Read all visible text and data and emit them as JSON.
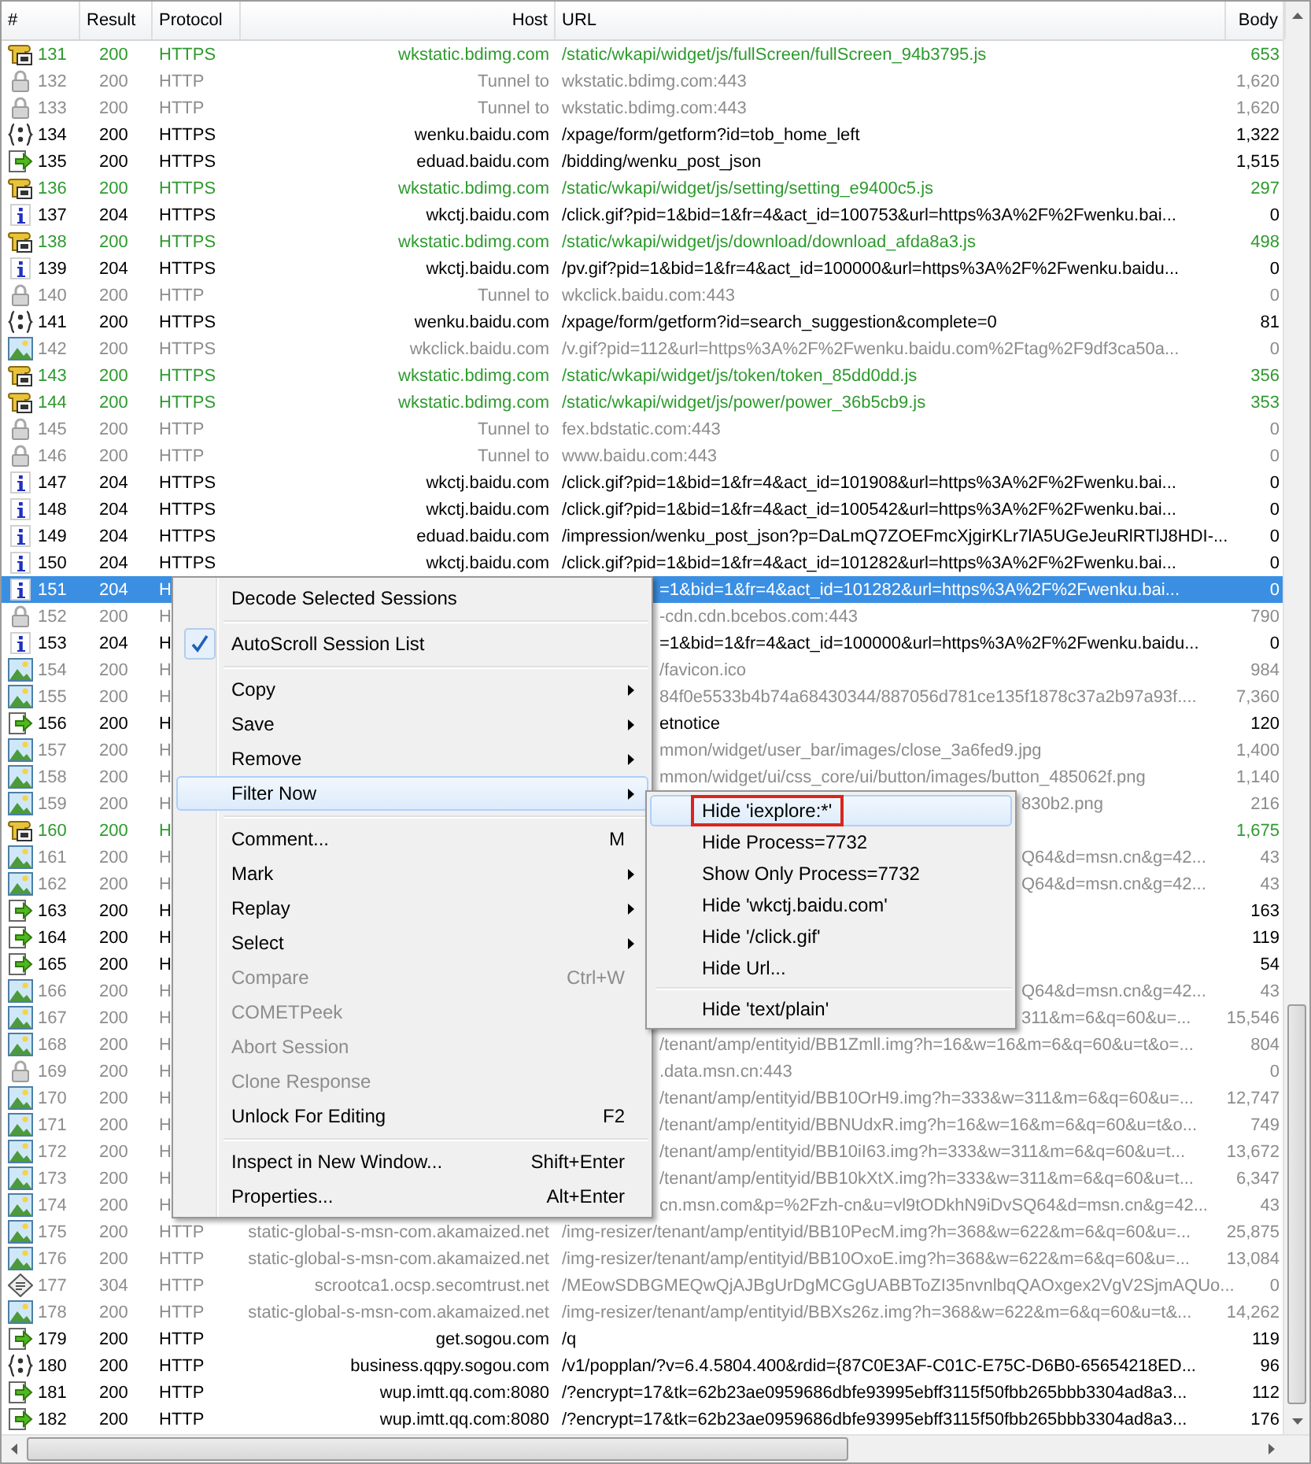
{
  "table": {
    "columns": [
      "#",
      "Result",
      "Protocol",
      "Host",
      "URL",
      "Body"
    ],
    "rows": [
      {
        "num": "131",
        "result": "200",
        "protocol": "HTTPS",
        "host": "wkstatic.bdimg.com",
        "url": "/static/wkapi/widget/js/fullScreen/fullScreen_94b3795.js",
        "body": "653",
        "kind": "script",
        "color": "#2e9a2e",
        "selected": false
      },
      {
        "num": "132",
        "result": "200",
        "protocol": "HTTP",
        "host": "Tunnel to",
        "url": "wkstatic.bdimg.com:443",
        "body": "1,620",
        "kind": "lock",
        "color": "#8c8c8c",
        "selected": false
      },
      {
        "num": "133",
        "result": "200",
        "protocol": "HTTP",
        "host": "Tunnel to",
        "url": "wkstatic.bdimg.com:443",
        "body": "1,620",
        "kind": "lock",
        "color": "#8c8c8c",
        "selected": false
      },
      {
        "num": "134",
        "result": "200",
        "protocol": "HTTPS",
        "host": "wenku.baidu.com",
        "url": "/xpage/form/getform?id=tob_home_left",
        "body": "1,322",
        "kind": "braces",
        "color": "#000000",
        "selected": false
      },
      {
        "num": "135",
        "result": "200",
        "protocol": "HTTPS",
        "host": "eduad.baidu.com",
        "url": "/bidding/wenku_post_json",
        "body": "1,515",
        "kind": "arrow",
        "color": "#000000",
        "selected": false
      },
      {
        "num": "136",
        "result": "200",
        "protocol": "HTTPS",
        "host": "wkstatic.bdimg.com",
        "url": "/static/wkapi/widget/js/setting/setting_e9400c5.js",
        "body": "297",
        "kind": "script",
        "color": "#2e9a2e",
        "selected": false
      },
      {
        "num": "137",
        "result": "204",
        "protocol": "HTTPS",
        "host": "wkctj.baidu.com",
        "url": "/click.gif?pid=1&bid=1&fr=4&act_id=100753&url=https%3A%2F%2Fwenku.bai...",
        "body": "0",
        "kind": "info",
        "color": "#000000",
        "selected": false
      },
      {
        "num": "138",
        "result": "200",
        "protocol": "HTTPS",
        "host": "wkstatic.bdimg.com",
        "url": "/static/wkapi/widget/js/download/download_afda8a3.js",
        "body": "498",
        "kind": "script",
        "color": "#2e9a2e",
        "selected": false
      },
      {
        "num": "139",
        "result": "204",
        "protocol": "HTTPS",
        "host": "wkctj.baidu.com",
        "url": "/pv.gif?pid=1&bid=1&fr=4&act_id=100000&url=https%3A%2F%2Fwenku.baidu...",
        "body": "0",
        "kind": "info",
        "color": "#000000",
        "selected": false
      },
      {
        "num": "140",
        "result": "200",
        "protocol": "HTTP",
        "host": "Tunnel to",
        "url": "wkclick.baidu.com:443",
        "body": "0",
        "kind": "lock",
        "color": "#8c8c8c",
        "selected": false
      },
      {
        "num": "141",
        "result": "200",
        "protocol": "HTTPS",
        "host": "wenku.baidu.com",
        "url": "/xpage/form/getform?id=search_suggestion&complete=0",
        "body": "81",
        "kind": "braces",
        "color": "#000000",
        "selected": false
      },
      {
        "num": "142",
        "result": "200",
        "protocol": "HTTPS",
        "host": "wkclick.baidu.com",
        "url": "/v.gif?pid=112&url=https%3A%2F%2Fwenku.baidu.com%2Ftag%2F9df3ca50a...",
        "body": "0",
        "kind": "image",
        "color": "#8c8c8c",
        "selected": false
      },
      {
        "num": "143",
        "result": "200",
        "protocol": "HTTPS",
        "host": "wkstatic.bdimg.com",
        "url": "/static/wkapi/widget/js/token/token_85dd0dd.js",
        "body": "356",
        "kind": "script",
        "color": "#2e9a2e",
        "selected": false
      },
      {
        "num": "144",
        "result": "200",
        "protocol": "HTTPS",
        "host": "wkstatic.bdimg.com",
        "url": "/static/wkapi/widget/js/power/power_36b5cb9.js",
        "body": "353",
        "kind": "script",
        "color": "#2e9a2e",
        "selected": false
      },
      {
        "num": "145",
        "result": "200",
        "protocol": "HTTP",
        "host": "Tunnel to",
        "url": "fex.bdstatic.com:443",
        "body": "0",
        "kind": "lock",
        "color": "#8c8c8c",
        "selected": false
      },
      {
        "num": "146",
        "result": "200",
        "protocol": "HTTP",
        "host": "Tunnel to",
        "url": "www.baidu.com:443",
        "body": "0",
        "kind": "lock",
        "color": "#8c8c8c",
        "selected": false
      },
      {
        "num": "147",
        "result": "204",
        "protocol": "HTTPS",
        "host": "wkctj.baidu.com",
        "url": "/click.gif?pid=1&bid=1&fr=4&act_id=101908&url=https%3A%2F%2Fwenku.bai...",
        "body": "0",
        "kind": "info",
        "color": "#000000",
        "selected": false
      },
      {
        "num": "148",
        "result": "204",
        "protocol": "HTTPS",
        "host": "wkctj.baidu.com",
        "url": "/click.gif?pid=1&bid=1&fr=4&act_id=100542&url=https%3A%2F%2Fwenku.bai...",
        "body": "0",
        "kind": "info",
        "color": "#000000",
        "selected": false
      },
      {
        "num": "149",
        "result": "204",
        "protocol": "HTTPS",
        "host": "eduad.baidu.com",
        "url": "/impression/wenku_post_json?p=DaLmQ7ZOEFmcXjgirKLr7lA5UGeJeuRlRTlJ8HDI-...",
        "body": "0",
        "kind": "info",
        "color": "#000000",
        "selected": false
      },
      {
        "num": "150",
        "result": "204",
        "protocol": "HTTPS",
        "host": "wkctj.baidu.com",
        "url": "/click.gif?pid=1&bid=1&fr=4&act_id=101282&url=https%3A%2F%2Fwenku.bai...",
        "body": "0",
        "kind": "info",
        "color": "#000000",
        "selected": false
      },
      {
        "num": "151",
        "result": "204",
        "protocol": "H",
        "url": "=1&bid=1&fr=4&act_id=101282&url=https%3A%2F%2Fwenku.bai...",
        "body": "0",
        "kind": "info",
        "selected": true
      },
      {
        "num": "152",
        "result": "200",
        "protocol": "H",
        "url": "-cdn.cdn.bcebos.com:443",
        "body": "790",
        "kind": "lock",
        "color": "#8c8c8c",
        "selected": false
      },
      {
        "num": "153",
        "result": "204",
        "protocol": "H",
        "url": "=1&bid=1&fr=4&act_id=100000&url=https%3A%2F%2Fwenku.baidu...",
        "body": "0",
        "kind": "info",
        "color": "#000000",
        "selected": false
      },
      {
        "num": "154",
        "result": "200",
        "protocol": "H",
        "url": "/favicon.ico",
        "body": "984",
        "kind": "image",
        "color": "#8c8c8c",
        "selected": false
      },
      {
        "num": "155",
        "result": "200",
        "protocol": "H",
        "url": "84f0e5533b4b74a68430344/887056d781ce135f1878c37a2b97a93f....",
        "body": "7,360",
        "kind": "image",
        "color": "#8c8c8c",
        "selected": false
      },
      {
        "num": "156",
        "result": "200",
        "protocol": "H",
        "url": "etnotice",
        "body": "120",
        "kind": "arrow",
        "color": "#000000",
        "selected": false
      },
      {
        "num": "157",
        "result": "200",
        "protocol": "H",
        "url": "mmon/widget/user_bar/images/close_3a6fed9.jpg",
        "body": "1,400",
        "kind": "image",
        "color": "#8c8c8c",
        "selected": false
      },
      {
        "num": "158",
        "result": "200",
        "protocol": "H",
        "url": "mmon/widget/ui/css_core/ui/button/images/button_485062f.png",
        "body": "1,140",
        "kind": "image",
        "color": "#8c8c8c",
        "selected": false
      },
      {
        "num": "159",
        "result": "200",
        "protocol": "H",
        "url": "830b2.png",
        "body": "216",
        "kind": "image",
        "color": "#8c8c8c",
        "selected": false
      },
      {
        "num": "160",
        "result": "200",
        "protocol": "H",
        "body": "1,675",
        "kind": "script",
        "color": "#2e9a2e",
        "selected": false
      },
      {
        "num": "161",
        "result": "200",
        "protocol": "H",
        "url": "Q64&d=msn.cn&g=42...",
        "body": "43",
        "kind": "image",
        "color": "#8c8c8c",
        "selected": false
      },
      {
        "num": "162",
        "result": "200",
        "protocol": "H",
        "url": "Q64&d=msn.cn&g=42...",
        "body": "43",
        "kind": "image",
        "color": "#8c8c8c",
        "selected": false
      },
      {
        "num": "163",
        "result": "200",
        "protocol": "H",
        "body": "163",
        "kind": "arrow",
        "color": "#000000",
        "selected": false
      },
      {
        "num": "164",
        "result": "200",
        "protocol": "H",
        "body": "119",
        "kind": "arrow",
        "color": "#000000",
        "selected": false
      },
      {
        "num": "165",
        "result": "200",
        "protocol": "H",
        "body": "54",
        "kind": "arrow",
        "color": "#000000",
        "selected": false
      },
      {
        "num": "166",
        "result": "200",
        "protocol": "H",
        "url": "Q64&d=msn.cn&g=42...",
        "body": "43",
        "kind": "image",
        "color": "#8c8c8c",
        "selected": false
      },
      {
        "num": "167",
        "result": "200",
        "protocol": "H",
        "url": "311&m=6&q=60&u=...",
        "body": "15,546",
        "kind": "image",
        "color": "#8c8c8c",
        "selected": false
      },
      {
        "num": "168",
        "result": "200",
        "protocol": "H",
        "url": "/tenant/amp/entityid/BB1Zmll.img?h=16&w=16&m=6&q=60&u=t&o=...",
        "body": "804",
        "kind": "image",
        "color": "#8c8c8c",
        "selected": false
      },
      {
        "num": "169",
        "result": "200",
        "protocol": "H",
        "url": ".data.msn.cn:443",
        "body": "0",
        "kind": "lock",
        "color": "#8c8c8c",
        "selected": false
      },
      {
        "num": "170",
        "result": "200",
        "protocol": "H",
        "url": "/tenant/amp/entityid/BB10OrH9.img?h=333&w=311&m=6&q=60&u=...",
        "body": "12,747",
        "kind": "image",
        "color": "#8c8c8c",
        "selected": false
      },
      {
        "num": "171",
        "result": "200",
        "protocol": "H",
        "url": "/tenant/amp/entityid/BBNUdxR.img?h=16&w=16&m=6&q=60&u=t&o...",
        "body": "749",
        "kind": "image",
        "color": "#8c8c8c",
        "selected": false
      },
      {
        "num": "172",
        "result": "200",
        "protocol": "H",
        "url": "/tenant/amp/entityid/BB10iI63.img?h=333&w=311&m=6&q=60&u=t...",
        "body": "13,672",
        "kind": "image",
        "color": "#8c8c8c",
        "selected": false
      },
      {
        "num": "173",
        "result": "200",
        "protocol": "H",
        "url": "/tenant/amp/entityid/BB10kXtX.img?h=333&w=311&m=6&q=60&u=t...",
        "body": "6,347",
        "kind": "image",
        "color": "#8c8c8c",
        "selected": false
      },
      {
        "num": "174",
        "result": "200",
        "protocol": "H",
        "url": "cn.msn.com&p=%2Fzh-cn&u=vl9tODkhN9iDvSQ64&d=msn.cn&g=42...",
        "body": "43",
        "kind": "image",
        "color": "#8c8c8c",
        "selected": false
      },
      {
        "num": "175",
        "result": "200",
        "protocol": "HTTP",
        "host": "static-global-s-msn-com.akamaized.net",
        "url": "/img-resizer/tenant/amp/entityid/BB10PecM.img?h=368&w=622&m=6&q=60&u=...",
        "body": "25,875",
        "kind": "image",
        "color": "#8c8c8c",
        "selected": false
      },
      {
        "num": "176",
        "result": "200",
        "protocol": "HTTP",
        "host": "static-global-s-msn-com.akamaized.net",
        "url": "/img-resizer/tenant/amp/entityid/BB10OxoE.img?h=368&w=622&m=6&q=60&u=...",
        "body": "13,084",
        "kind": "image",
        "color": "#8c8c8c",
        "selected": false
      },
      {
        "num": "177",
        "result": "304",
        "protocol": "HTTP",
        "host": "scrootca1.ocsp.secomtrust.net",
        "url": "/MEowSDBGMEQwQjAJBgUrDgMCGgUABBToZI35nvnlbqQAOxgex2VgV2SjmAQUo...",
        "body": "0",
        "kind": "certificate",
        "color": "#8c8c8c",
        "selected": false
      },
      {
        "num": "178",
        "result": "200",
        "protocol": "HTTP",
        "host": "static-global-s-msn-com.akamaized.net",
        "url": "/img-resizer/tenant/amp/entityid/BBXs26z.img?h=368&w=622&m=6&q=60&u=t&...",
        "body": "14,262",
        "kind": "image",
        "color": "#8c8c8c",
        "selected": false
      },
      {
        "num": "179",
        "result": "200",
        "protocol": "HTTP",
        "host": "get.sogou.com",
        "url": "/q",
        "body": "119",
        "kind": "arrow",
        "color": "#000000",
        "selected": false
      },
      {
        "num": "180",
        "result": "200",
        "protocol": "HTTP",
        "host": "business.qqpy.sogou.com",
        "url": "/v1/popplan/?v=6.4.5804.400&rdid={87C0E3AF-C01C-E75C-D6B0-65654218ED...",
        "body": "96",
        "kind": "braces",
        "color": "#000000",
        "selected": false
      },
      {
        "num": "181",
        "result": "200",
        "protocol": "HTTP",
        "host": "wup.imtt.qq.com:8080",
        "url": "/?encrypt=17&tk=62b23ae0959686dbfe93995ebff3115f50fbb265bbb3304ad8a3...",
        "body": "112",
        "kind": "arrow",
        "color": "#000000",
        "selected": false
      },
      {
        "num": "182",
        "result": "200",
        "protocol": "HTTP",
        "host": "wup.imtt.qq.com:8080",
        "url": "/?encrypt=17&tk=62b23ae0959686dbfe93995ebff3115f50fbb265bbb3304ad8a3...",
        "body": "176",
        "kind": "arrow",
        "color": "#000000",
        "selected": false
      }
    ]
  },
  "context_menu": {
    "items": [
      {
        "kind": "item",
        "label": "Decode Selected Sessions",
        "submenu": false,
        "checked": false,
        "disabled": false,
        "selected": false
      },
      {
        "kind": "separator"
      },
      {
        "kind": "item",
        "label": "AutoScroll Session List",
        "submenu": false,
        "checked": true,
        "disabled": false,
        "selected": false
      },
      {
        "kind": "separator"
      },
      {
        "kind": "item",
        "label": "Copy",
        "submenu": true,
        "checked": false,
        "disabled": false,
        "selected": false
      },
      {
        "kind": "item",
        "label": "Save",
        "submenu": true,
        "checked": false,
        "disabled": false,
        "selected": false
      },
      {
        "kind": "item",
        "label": "Remove",
        "submenu": true,
        "checked": false,
        "disabled": false,
        "selected": false
      },
      {
        "kind": "item",
        "label": "Filter Now",
        "submenu": true,
        "checked": false,
        "disabled": false,
        "selected": true
      },
      {
        "kind": "separator"
      },
      {
        "kind": "item",
        "label": "Comment...",
        "shortcut": "M",
        "submenu": false,
        "checked": false,
        "disabled": false,
        "selected": false
      },
      {
        "kind": "item",
        "label": "Mark",
        "submenu": true,
        "checked": false,
        "disabled": false,
        "selected": false
      },
      {
        "kind": "item",
        "label": "Replay",
        "submenu": true,
        "checked": false,
        "disabled": false,
        "selected": false
      },
      {
        "kind": "item",
        "label": "Select",
        "submenu": true,
        "checked": false,
        "disabled": false,
        "selected": false
      },
      {
        "kind": "item",
        "label": "Compare",
        "shortcut": "Ctrl+W",
        "submenu": false,
        "checked": false,
        "disabled": true,
        "selected": false
      },
      {
        "kind": "item",
        "label": "COMETPeek",
        "submenu": false,
        "checked": false,
        "disabled": true,
        "selected": false
      },
      {
        "kind": "item",
        "label": "Abort Session",
        "submenu": false,
        "checked": false,
        "disabled": true,
        "selected": false
      },
      {
        "kind": "item",
        "label": "Clone Response",
        "submenu": false,
        "checked": false,
        "disabled": true,
        "selected": false
      },
      {
        "kind": "item",
        "label": "Unlock For Editing",
        "shortcut": "F2",
        "submenu": false,
        "checked": false,
        "disabled": false,
        "selected": false
      },
      {
        "kind": "separator"
      },
      {
        "kind": "item",
        "label": "Inspect in New Window...",
        "shortcut": "Shift+Enter",
        "submenu": false,
        "checked": false,
        "disabled": false,
        "selected": false
      },
      {
        "kind": "item",
        "label": "Properties...",
        "shortcut": "Alt+Enter",
        "submenu": false,
        "checked": false,
        "disabled": false,
        "selected": false
      }
    ]
  },
  "submenu": {
    "items": [
      {
        "kind": "item",
        "label": "Hide 'iexplore:*'",
        "selected": true,
        "marked": true
      },
      {
        "kind": "item",
        "label": "Hide Process=7732",
        "selected": false,
        "marked": false
      },
      {
        "kind": "item",
        "label": "Show Only Process=7732",
        "selected": false,
        "marked": false
      },
      {
        "kind": "item",
        "label": "Hide 'wkctj.baidu.com'",
        "selected": false,
        "marked": false
      },
      {
        "kind": "item",
        "label": "Hide '/click.gif'",
        "selected": false,
        "marked": false
      },
      {
        "kind": "item",
        "label": "Hide Url...",
        "selected": false,
        "marked": false
      },
      {
        "kind": "separator"
      },
      {
        "kind": "item",
        "label": "Hide 'text/plain'",
        "selected": false,
        "marked": false
      }
    ]
  }
}
